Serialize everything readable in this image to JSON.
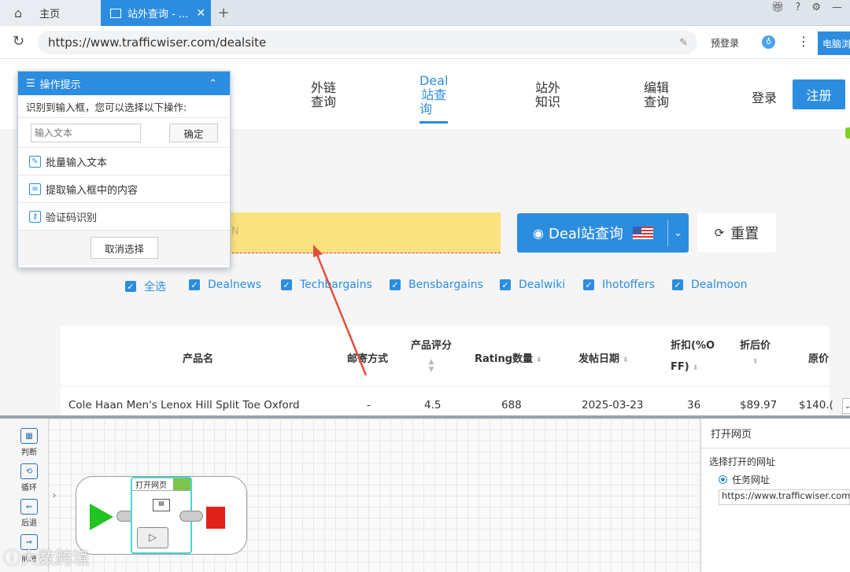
{
  "browser": {
    "tabs": [
      {
        "label": "主页"
      },
      {
        "label": "站外查询 - ..."
      }
    ],
    "new_tab": "+",
    "url": "https://www.trafficwiser.com/dealsite",
    "prelogin": "预登录",
    "pc_label": "电脑浏"
  },
  "nav": {
    "items": [
      {
        "line1": "外链",
        "line2": "查询"
      },
      {
        "line1": "Deal",
        "line2": "站查",
        "line3": "询"
      },
      {
        "line1": "站外",
        "line2": "知识"
      },
      {
        "line1": "编辑",
        "line2": "查询"
      }
    ],
    "login": "登录",
    "register": "注册"
  },
  "search": {
    "placeholder_fragment": "IN",
    "button": "Deal站查询",
    "reset": "重置"
  },
  "filters": [
    "全选",
    "Dealnews",
    "Techbargains",
    "Bensbargains",
    "Dealwiki",
    "Ihotoffers",
    "Dealmoon"
  ],
  "table": {
    "headers": [
      "产品名",
      "邮寄方式",
      "产品评分",
      "Rating数量",
      "发帖日期",
      "折扣(%O",
      "FF)",
      "折后价",
      "原价"
    ],
    "row": [
      "Cole Haan Men's Lenox Hill Split Toe Oxford",
      "-",
      "4.5",
      "688",
      "2025-03-23",
      "36",
      "$89.97",
      "$140.("
    ]
  },
  "popup": {
    "title": "操作提示",
    "hint": "识别到输入框，您可以选择以下操作:",
    "input_placeholder": "输入文本",
    "confirm": "确定",
    "actions": [
      "批量输入文本",
      "提取输入框中的内容",
      "验证码识别"
    ],
    "cancel": "取消选择"
  },
  "designer": {
    "tools": [
      "判断",
      "循环",
      "后退",
      "前进"
    ],
    "node_label": "打开网页",
    "props_title": "打开网页",
    "props_label": "选择打开的网址",
    "radio_label": "任务网址",
    "props_url": "https://www.trafficwiser.com/de",
    "watermark": "大数跨境"
  },
  "colors": {
    "accent": "#2c8de0",
    "highlight": "#f9e27f",
    "arrow": "#e0503c"
  }
}
